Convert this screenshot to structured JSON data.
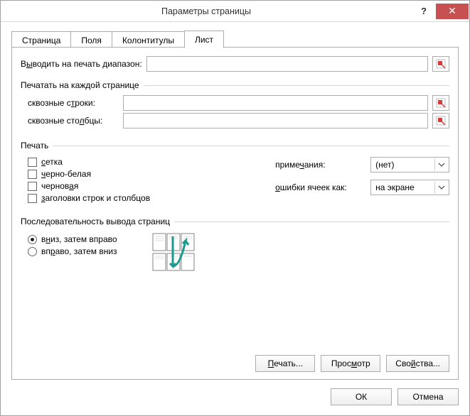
{
  "window": {
    "title": "Параметры страницы",
    "help": "?",
    "close": "✕"
  },
  "tabs": {
    "page": "Страница",
    "fields": "Поля",
    "headers": "Колонтитулы",
    "sheet": "Лист"
  },
  "printRange": {
    "label_pre": "В",
    "label_u": "ы",
    "label_post": "водить на печать диапазон:",
    "value": ""
  },
  "repeat": {
    "legend": "Печатать на каждой странице",
    "rows_label_pre": "сквозные с",
    "rows_label_u": "т",
    "rows_label_post": "роки:",
    "rows_value": "",
    "cols_label_pre": "сквозные сто",
    "cols_label_u": "л",
    "cols_label_post": "бцы:",
    "cols_value": ""
  },
  "print": {
    "legend": "Печать",
    "grid_pre": "",
    "grid_u": "с",
    "grid_post": "етка",
    "bw_pre": "",
    "bw_u": "ч",
    "bw_post": "ерно-белая",
    "draft_pre": "чернов",
    "draft_u": "а",
    "draft_post": "я",
    "hdrs_pre": "",
    "hdrs_u": "з",
    "hdrs_post": "аголовки строк и столбцов",
    "comments_label_pre": "приме",
    "comments_label_u": "ч",
    "comments_label_post": "ания:",
    "comments_value": "(нет)",
    "errors_label_pre": "ошибки ячеек как:",
    "errors_label_u": "",
    "errors_label_post": "",
    "errors_label": "ошибки ячеек как:",
    "errors_underline": "о",
    "errors_post": "шибки ячеек как:",
    "errors_value": "на экране"
  },
  "order": {
    "legend": "Последовательность вывода страниц",
    "down_pre": "в",
    "down_u": "н",
    "down_post": "из, затем вправо",
    "across_pre": "вп",
    "across_u": "р",
    "across_post": "аво, затем вниз"
  },
  "buttons": {
    "print": "Печать...",
    "print_u": "П",
    "print_post": "ечать...",
    "preview_pre": "Прос",
    "preview_u": "м",
    "preview_post": "отр",
    "props_pre": "Сво",
    "props_u": "й",
    "props_post": "ства...",
    "ok": "ОК",
    "cancel": "Отмена"
  }
}
